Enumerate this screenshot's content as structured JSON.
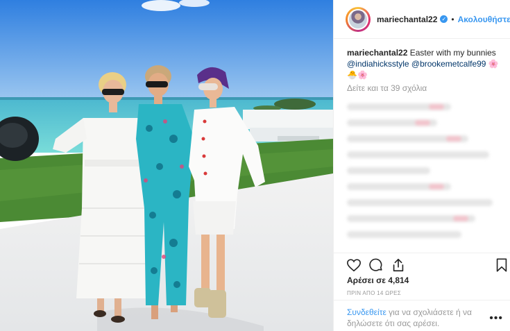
{
  "post": {
    "username": "mariechantal22",
    "follow_label": "Ακολουθήστε",
    "separator": "•",
    "verified_mark": "✓",
    "caption": {
      "username": "mariechantal22",
      "text": "Easter with my bunnies",
      "tag1": "@indiahicksstyle",
      "tag2": "@brookemetcalfe99",
      "emojis": "🌸🐣🌸"
    },
    "view_comments": "Δείτε και τα 39 σχόλια",
    "likes": "Αρέσει σε 4,814",
    "time": "ΠΡΙΝ ΑΠΟ 14 ΩΡΕΣ",
    "footer": {
      "login": "Συνδεθείτε",
      "text": " για να σχολιάσετε ή να δηλώσετε ότι σας αρέσει."
    },
    "more": "•••"
  },
  "icons": {
    "like": "heart-icon",
    "comment": "comment-icon",
    "share": "share-icon",
    "save": "bookmark-icon"
  },
  "colors": {
    "link": "#3897f0",
    "muted": "#999999",
    "text": "#262626"
  }
}
